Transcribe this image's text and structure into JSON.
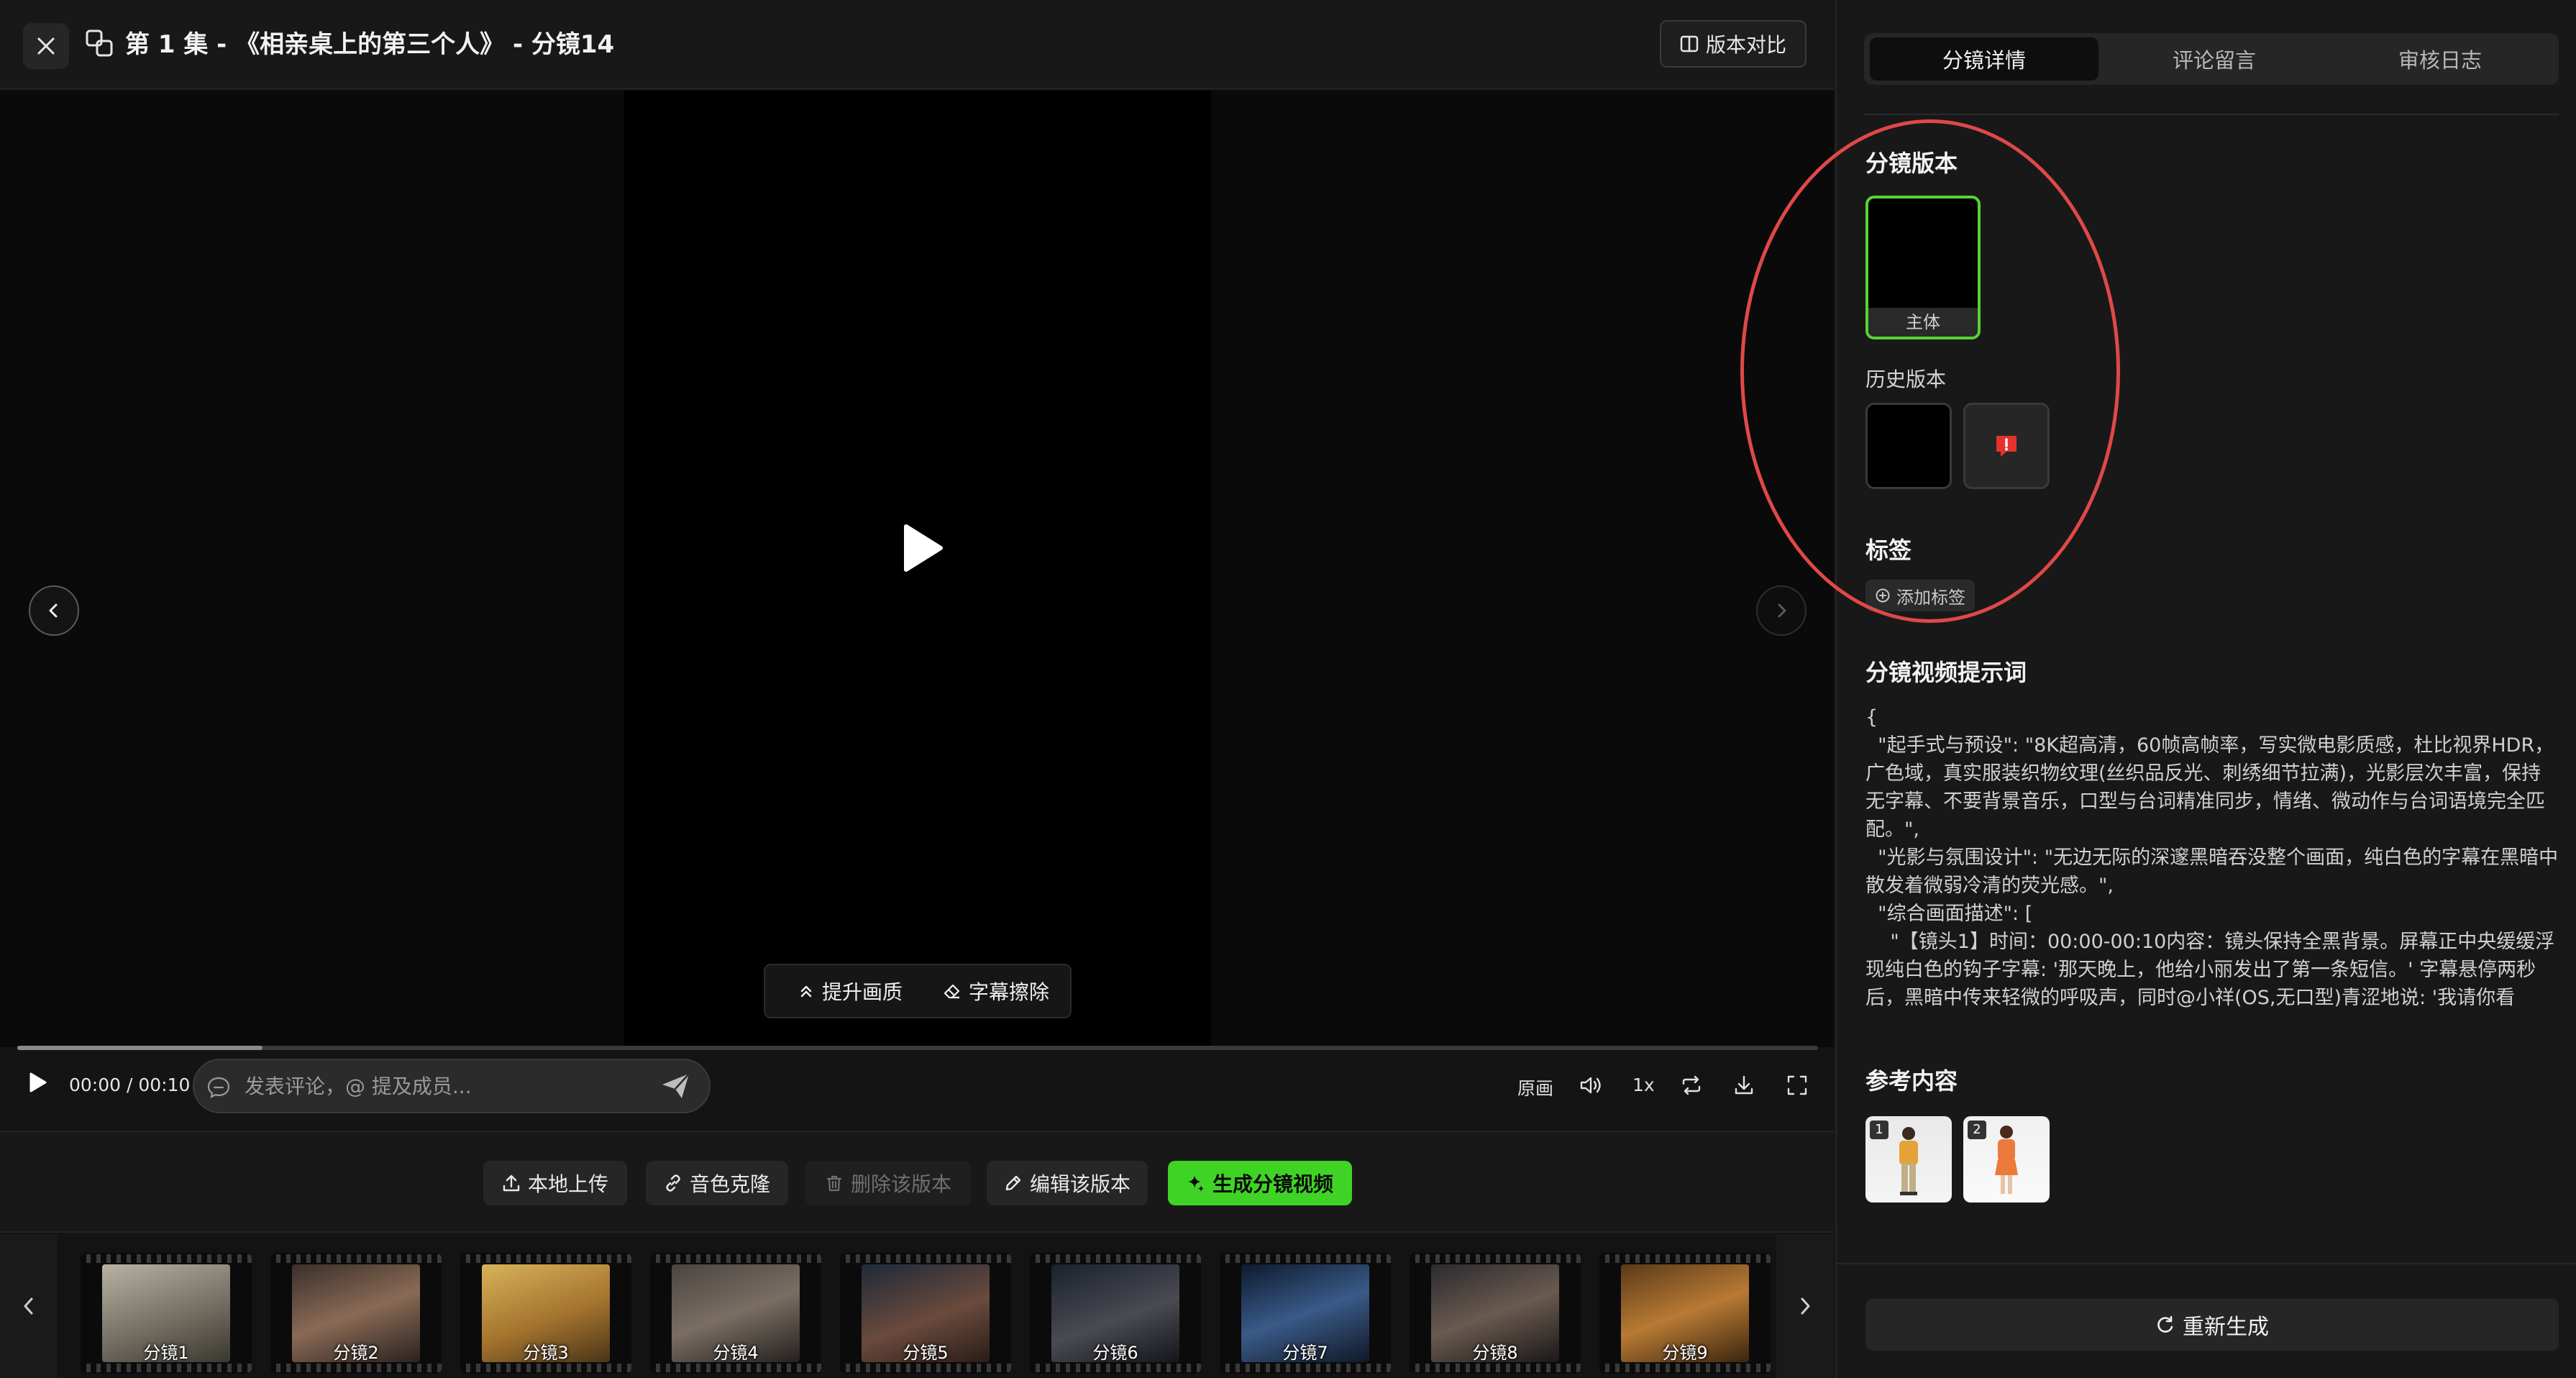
{
  "header": {
    "title": "第 1 集 - 《相亲桌上的第三个人》 - 分镜14",
    "compare_label": "版本对比"
  },
  "player": {
    "enhance_label": "提升画质",
    "erase_label": "字幕擦除",
    "time": "00:00 / 00:10",
    "progress": 0.136,
    "comment_placeholder": "发表评论，@ 提及成员...",
    "original_label": "原画",
    "speed_label": "1x"
  },
  "actions": {
    "upload": "本地上传",
    "voice_clone": "音色克隆",
    "delete_version": "删除该版本",
    "edit_version": "编辑该版本",
    "generate": "生成分镜视频"
  },
  "filmstrip": [
    {
      "label": "分镜1"
    },
    {
      "label": "分镜2"
    },
    {
      "label": "分镜3"
    },
    {
      "label": "分镜4"
    },
    {
      "label": "分镜5"
    },
    {
      "label": "分镜6"
    },
    {
      "label": "分镜7"
    },
    {
      "label": "分镜8"
    },
    {
      "label": "分镜9"
    }
  ],
  "sidebar": {
    "tabs": [
      "分镜详情",
      "评论留言",
      "审核日志"
    ],
    "version_title": "分镜版本",
    "main_version_label": "主体",
    "history_title": "历史版本",
    "tags_title": "标签",
    "add_tag": "添加标签",
    "prompt_title": "分镜视频提示词",
    "prompt_text": "{\n  \"起手式与预设\": \"8K超高清，60帧高帧率，写实微电影质感，杜比视界HDR，广色域，真实服装织物纹理(丝织品反光、刺绣细节拉满)，光影层次丰富，保持无字幕、不要背景音乐，口型与台词精准同步，情绪、微动作与台词语境完全匹配。\",\n  \"光影与氛围设计\": \"无边无际的深邃黑暗吞没整个画面，纯白色的字幕在黑暗中散发着微弱冷清的荧光感。\",\n  \"综合画面描述\": [\n    \"【镜头1】时间：00:00-00:10内容：镜头保持全黑背景。屏幕正中央缓缓浮现纯白色的钩子字幕: '那天晚上，他给小丽发出了第一条短信。' 字幕悬停两秒后，黑暗中传来轻微的呼吸声，同时@小祥(OS,无口型)青涩地说: '我请你看",
    "reference_title": "参考内容",
    "references": [
      "1",
      "2"
    ],
    "regenerate": "重新生成"
  },
  "colors": {
    "accent_green": "#3fd425",
    "selected_border": "#59d232",
    "annotation_red": "#e04848",
    "warning_red": "#e5322d"
  }
}
